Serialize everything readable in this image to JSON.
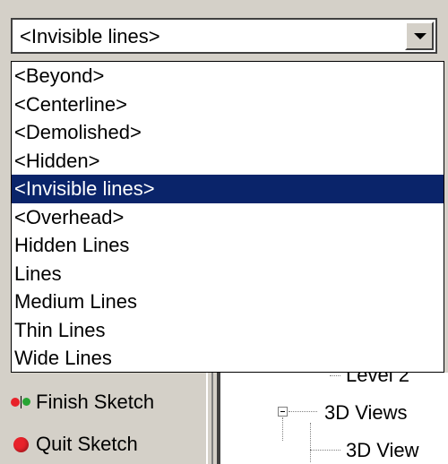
{
  "dropdown": {
    "selected_value": "<Invisible lines>",
    "options": [
      "<Beyond>",
      "<Centerline>",
      "<Demolished>",
      "<Hidden>",
      "<Invisible lines>",
      "<Overhead>",
      "Hidden Lines",
      "Lines",
      "Medium Lines",
      "Thin Lines",
      "Wide Lines"
    ],
    "highlighted_index": 4,
    "highlight_color": "#0a246a"
  },
  "sketch_panel": {
    "finish_label": "Finish Sketch",
    "finish_icon": "finish-sketch-icon",
    "quit_label": "Quit Sketch",
    "quit_icon": "quit-sketch-icon"
  },
  "project_tree": {
    "level2_label": "Level 2",
    "views3d_label": "3D Views",
    "view3d_child_label": "3D View"
  }
}
